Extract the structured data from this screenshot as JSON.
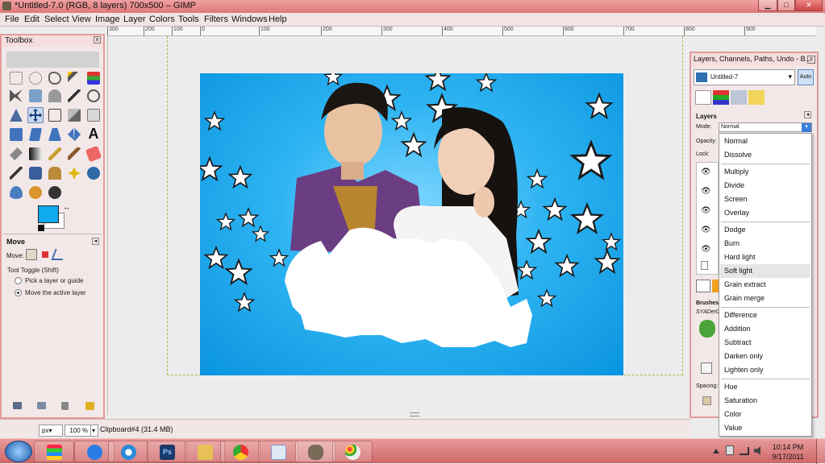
{
  "window": {
    "title": "*Untitled-7.0 (RGB, 8 layers) 700x500 – GIMP",
    "min": "▁",
    "max": "□",
    "close": "✕"
  },
  "menubar": [
    "File",
    "Edit",
    "Select",
    "View",
    "Image",
    "Layer",
    "Colors",
    "Tools",
    "Filters",
    "Windows",
    "Help"
  ],
  "ruler": [
    "300",
    "200",
    "100",
    "0",
    "100",
    "200",
    "300",
    "400",
    "500",
    "600",
    "700",
    "800",
    "900"
  ],
  "toolbox": {
    "title": "Toolbox",
    "close": "x",
    "text_tool_glyph": "A",
    "options_title": "Move",
    "move_label": "Move:",
    "tool_toggle": "Tool Toggle  (Shift)",
    "pick_layer": "Pick a layer or guide",
    "move_active": "Move the active layer",
    "fg_color": "#10aaee",
    "bg_color": "#ffffff"
  },
  "status": {
    "unit": "px▾",
    "zoom": "100 %",
    "zoom_arrow": "▾",
    "info": "Clipboard#4 (31.4 MB)"
  },
  "dock": {
    "title": "Layers, Channels, Paths, Undo - B...",
    "image_select": "Untitled-7",
    "select_arrow": "▾",
    "auto": "Auto",
    "layers_label": "Layers",
    "mode_label": "Mode:",
    "mode_value": "Normal",
    "opacity_label": "Opacity:",
    "lock_label": "Lock:",
    "brushes_label": "Brushes",
    "brush_name": "SYADer00",
    "spacing_label": "Spacing:"
  },
  "mode_menu": {
    "groups": [
      [
        "Normal",
        "Dissolve"
      ],
      [
        "Multiply",
        "Divide",
        "Screen",
        "Overlay"
      ],
      [
        "Dodge",
        "Burn",
        "Hard light",
        "Soft light",
        "Grain extract",
        "Grain merge"
      ],
      [
        "Difference",
        "Addition",
        "Subtract",
        "Darken only",
        "Lighten only"
      ],
      [
        "Hue",
        "Saturation",
        "Color",
        "Value"
      ]
    ],
    "highlighted": "Soft light"
  },
  "taskbar": {
    "apps": [
      "windows-explorer",
      "internet-explorer",
      "itunes",
      "photoshop",
      "file-explorer",
      "chrome",
      "document-viewer",
      "gimp",
      "paint"
    ],
    "app_glyphs": {
      "photoshop": "Ps"
    },
    "time": "10:14 PM",
    "date": "9/17/2011"
  },
  "colors": {
    "accent": "#e59a9a",
    "sky": "#1aa6ec",
    "highlight": "#3b7dd8"
  }
}
